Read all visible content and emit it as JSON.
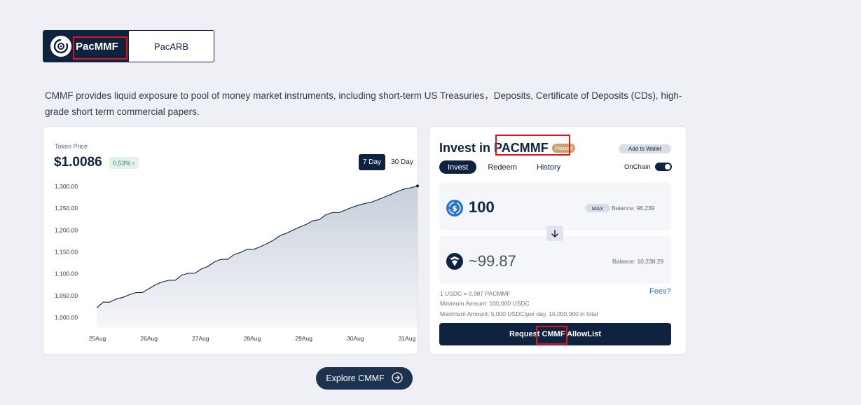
{
  "tabs": {
    "active_label": "PacMMF",
    "inactive_label": "PacARB",
    "logo_icon": "pac-logo-icon"
  },
  "description": "CMMF provides liquid exposure to pool of money market instruments, including short-term US Treasuries，Deposits, Certificate of Deposits (CDs), high-grade short term commercial papers.",
  "chart_card": {
    "token_price_label": "Token Price",
    "price": "$1.0086",
    "change": "0.53%",
    "change_icon": "arrow-up-icon",
    "periods": [
      "7 Day",
      "30 Day"
    ],
    "active_period": "7 Day"
  },
  "chart_data": {
    "type": "area",
    "x_labels": [
      "25Aug",
      "26Aug",
      "27Aug",
      "28Aug",
      "29Aug",
      "30Aug",
      "31Aug"
    ],
    "y_ticks": [
      "1,300.00",
      "1,250.00",
      "1,200.00",
      "1,150.00",
      "1,100.00",
      "1,050.00",
      "1,000.00"
    ],
    "ylim": [
      1000,
      1300
    ],
    "values": [
      1022,
      1035,
      1035,
      1042,
      1046,
      1052,
      1057,
      1057,
      1066,
      1075,
      1081,
      1085,
      1085,
      1097,
      1101,
      1101,
      1111,
      1117,
      1127,
      1133,
      1133,
      1144,
      1149,
      1156,
      1156,
      1162,
      1169,
      1177,
      1187,
      1193,
      1200,
      1207,
      1213,
      1221,
      1224,
      1235,
      1240,
      1240,
      1246,
      1252,
      1257,
      1261,
      1264,
      1270,
      1276,
      1282,
      1289,
      1294,
      1297,
      1301
    ],
    "colors": {
      "line": "#0e2340",
      "fill_top": "#c8cfdb",
      "fill_bottom": "#f4f6f9"
    }
  },
  "invest": {
    "title_prefix": "Invest in",
    "title_token": "PACMMF",
    "paused": "Paused",
    "add_wallet": "Add to Wallet",
    "subtabs": [
      "Invest",
      "Redeem",
      "History"
    ],
    "onchain_label": "OnChain",
    "input_amount": "100",
    "input_coin_icon": "usdc-icon",
    "max_label": "MAX",
    "input_balance": "Balance: 98,239",
    "swap_icon": "arrow-down-icon",
    "output_amount": "~99.87",
    "output_coin_icon": "pacmmf-token-icon",
    "output_balance": "Balance: 10,238.29",
    "rate": "1 USDC = 0.987 PACMMF",
    "minimum": "Minimum Amount: 100,000 USDC",
    "maximum": "Maximum Amount: 5,000 USDC/per day, 10,000,000 in total",
    "fees": "Fees?",
    "request_button": "Request CMMF AllowList"
  },
  "explore_button": "Explore CMMF",
  "explore_icon": "arrow-right-circle-icon",
  "accent_colors": {
    "navy": "#0e2340",
    "highlight_red": "#e0141e",
    "link_blue": "#2f6ec6",
    "paused_gold": "#c9a26a"
  }
}
